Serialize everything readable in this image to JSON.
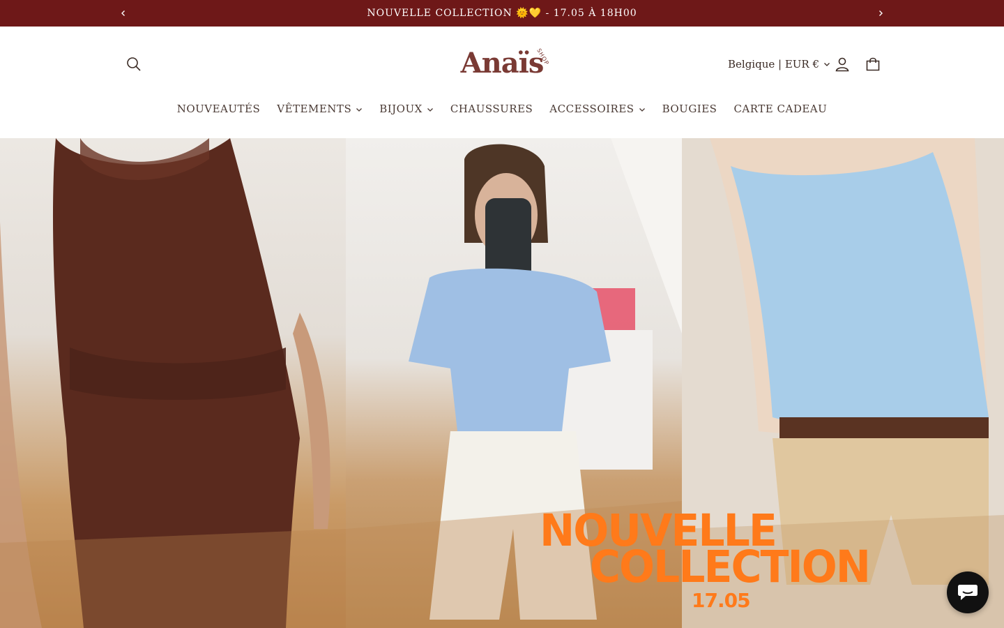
{
  "announcement": {
    "text": "NOUVELLE COLLECTION 🌞💛 - 17.05 À 18H00",
    "prev_icon": "chevron-left-icon",
    "next_icon": "chevron-right-icon",
    "bg_color": "#6e1818"
  },
  "header": {
    "logo_text": "Anaïs",
    "logo_sup": "SHOP",
    "country_selector": "Belgique | EUR €",
    "icons": [
      "search-icon",
      "user-icon",
      "cart-icon"
    ]
  },
  "nav": {
    "items": [
      {
        "label": "NOUVEAUTÉS",
        "has_dropdown": false
      },
      {
        "label": "VÊTEMENTS",
        "has_dropdown": true
      },
      {
        "label": "BIJOUX",
        "has_dropdown": true
      },
      {
        "label": "CHAUSSURES",
        "has_dropdown": false
      },
      {
        "label": "ACCESSOIRES",
        "has_dropdown": true
      },
      {
        "label": "BOUGIES",
        "has_dropdown": false
      },
      {
        "label": "CARTE CADEAU",
        "has_dropdown": false
      }
    ]
  },
  "hero": {
    "line1": "NOUVELLE",
    "line2": "COLLECTION",
    "date": "17.05",
    "accent_color": "#ff7a1a"
  },
  "chat": {
    "icon": "chat-icon"
  }
}
